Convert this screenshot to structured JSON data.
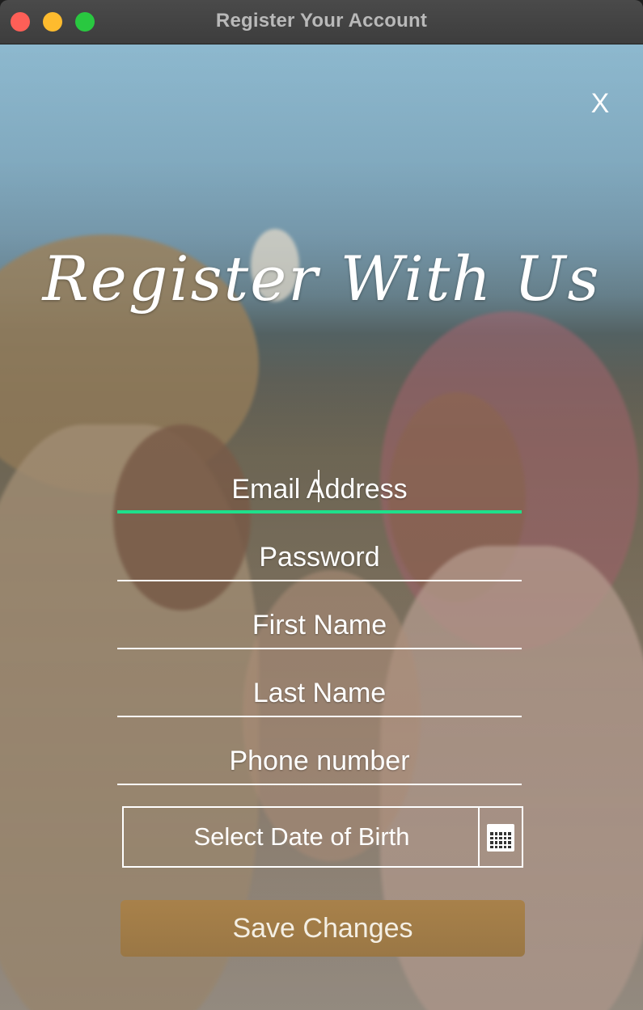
{
  "window": {
    "title": "Register Your Account"
  },
  "form": {
    "close_label": "X",
    "heading": "Register With Us",
    "fields": [
      {
        "placeholder": "Email Address",
        "focused": true
      },
      {
        "placeholder": "Password"
      },
      {
        "placeholder": "First Name"
      },
      {
        "placeholder": "Last Name"
      },
      {
        "placeholder": "Phone number"
      }
    ],
    "dob_label": "Select Date of Birth",
    "calendar_icon": "calendar-icon",
    "save_label": "Save Changes"
  },
  "colors": {
    "focus_underline": "#1ee08b",
    "button_bg": "#a0794a",
    "text": "#ffffff"
  }
}
